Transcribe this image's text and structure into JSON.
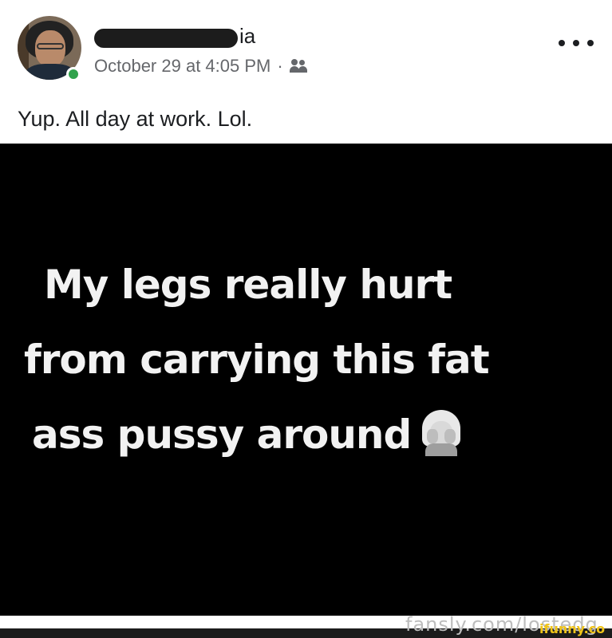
{
  "post": {
    "author_name_visible": "ia",
    "timestamp": "October 29 at 4:05 PM",
    "separator": "·",
    "audience_icon": "friends-icon",
    "more_icon": "more-options-icon",
    "caption": "Yup. All day at work. Lol."
  },
  "image": {
    "lines": [
      "My legs really hurt",
      "from carrying this fat",
      "ass pussy around"
    ],
    "emoji": "facepalm-woman-emoji",
    "background_color": "#000000",
    "text_color": "#f2f2f2"
  },
  "watermarks": {
    "fansly": "fansly.com/lostedg",
    "ifunny": "ifunny.co"
  },
  "colors": {
    "online_status": "#31a24c",
    "meta_text": "#65676b",
    "primary_text": "#1c1e21"
  }
}
